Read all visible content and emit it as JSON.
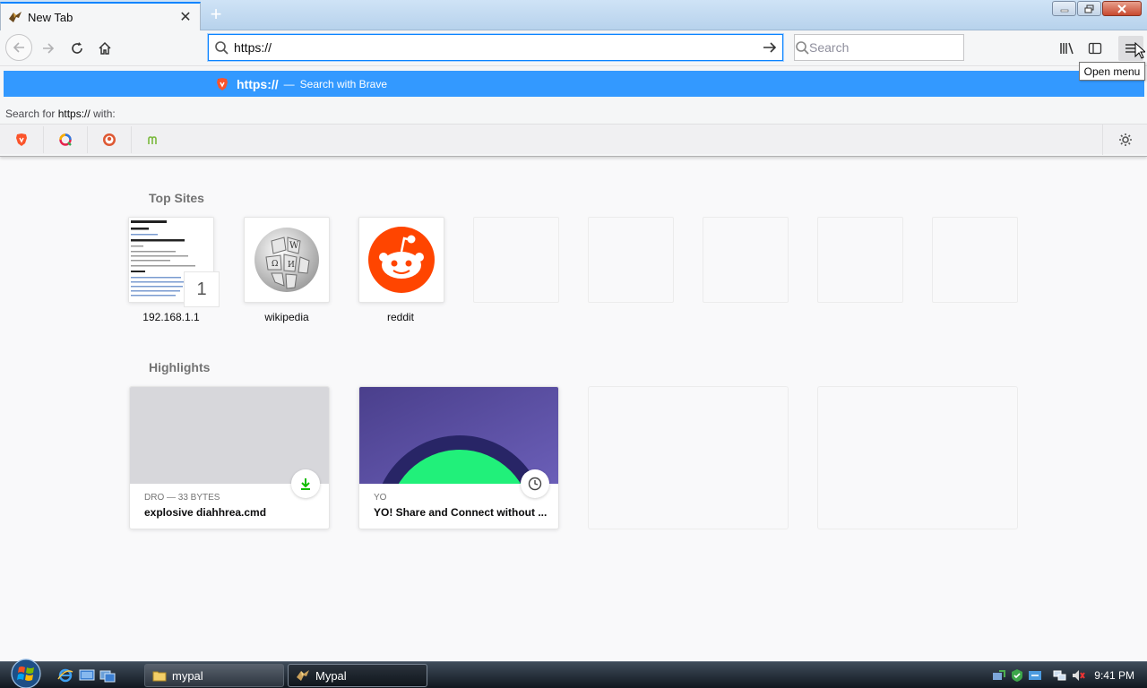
{
  "tab": {
    "title": "New Tab"
  },
  "window_controls": {
    "minimize": "minimize",
    "maximize": "restore",
    "close": "close"
  },
  "urlbar": {
    "value": "https://"
  },
  "searchbar": {
    "placeholder": "Search"
  },
  "tooltip": {
    "text": "Open menu"
  },
  "popup": {
    "suggestion_main": "https://",
    "suggestion_sep": "—",
    "suggestion_action": "Search with Brave",
    "search_for_prefix": "Search for",
    "search_for_query": "https://",
    "search_for_suffix": "with:",
    "engines": [
      "brave-icon",
      "qwant-icon",
      "duckduckgo-icon",
      "mojeek-icon"
    ]
  },
  "top_sites": {
    "title": "Top Sites",
    "items": [
      {
        "label": "192.168.1.1",
        "badge": "1"
      },
      {
        "label": "wikipedia"
      },
      {
        "label": "reddit"
      }
    ]
  },
  "highlights": {
    "title": "Highlights",
    "cards": [
      {
        "meta": "DRO — 33 BYTES",
        "title": "explosive diahhrea.cmd",
        "icon": "download-icon"
      },
      {
        "meta": "YO",
        "title": "YO! Share and Connect without ...",
        "icon": "clock-icon"
      }
    ]
  },
  "taskbar": {
    "tasks": [
      {
        "label": "mypal"
      },
      {
        "label": "Mypal"
      }
    ],
    "clock": "9:41 PM"
  },
  "colors": {
    "accent": "#0a84ff",
    "suggestion_bg": "#3399ff",
    "reddit": "#ff4500",
    "download_green": "#12bc00",
    "highlight_bg": "#5a4fa5",
    "highlight_green": "#21f07a"
  }
}
